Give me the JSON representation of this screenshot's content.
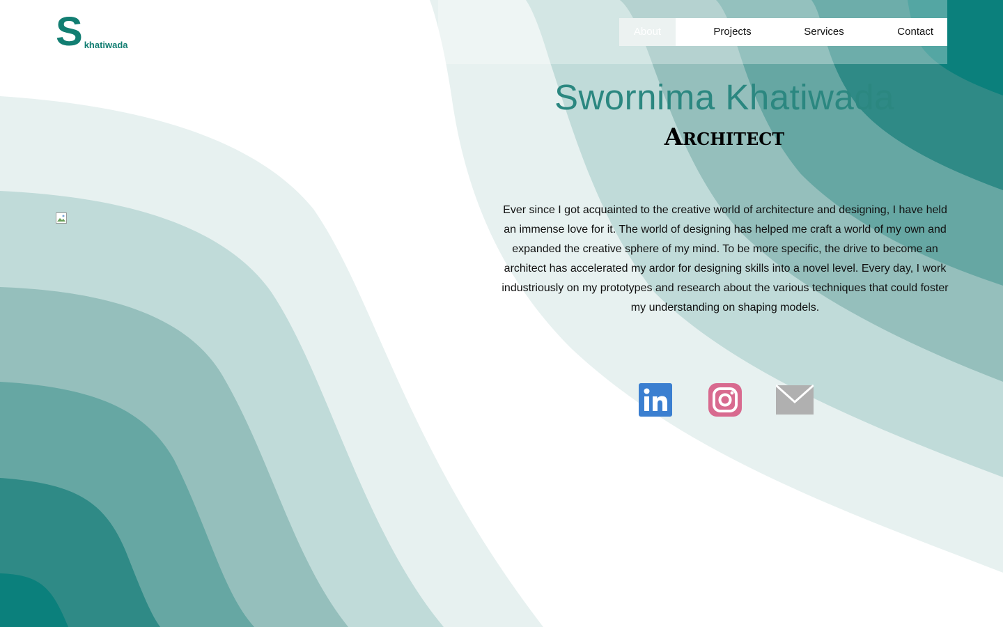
{
  "brand": {
    "letter": "S",
    "name": "khatiwada",
    "color": "#127e72"
  },
  "nav": {
    "items": [
      {
        "label": "About",
        "active": true
      },
      {
        "label": "Projects"
      },
      {
        "label": "Services"
      },
      {
        "label": "Contact"
      }
    ]
  },
  "hero": {
    "name": "Swornima Khatiwada",
    "role": "Architect",
    "bio": "Ever since I got acquainted to the creative world of architecture and designing, I have held an immense love for it. The world of designing has helped me craft a world of my own and expanded the creative sphere of my mind. To be more specific, the drive to become an architect has accelerated my ardor for designing skills into a novel level. Every day, I work industriously on my prototypes and research about the various techniques that could foster my understanding on shaping models."
  },
  "portrait": {
    "icon": "broken-image-icon"
  },
  "social": [
    {
      "icon": "linkedin-icon",
      "color": "#3b7fd0"
    },
    {
      "icon": "instagram-icon",
      "color": "#d86a8f"
    },
    {
      "icon": "mail-icon",
      "color": "#b0b0b0"
    }
  ],
  "colors": {
    "accent": "#2b8780",
    "wave_1": "#e7f1f0",
    "wave_2": "#c0dbd9",
    "wave_3": "#95bfbc",
    "wave_4": "#66a7a3",
    "wave_5": "#2f8a86",
    "wave_6": "#0b807c"
  }
}
